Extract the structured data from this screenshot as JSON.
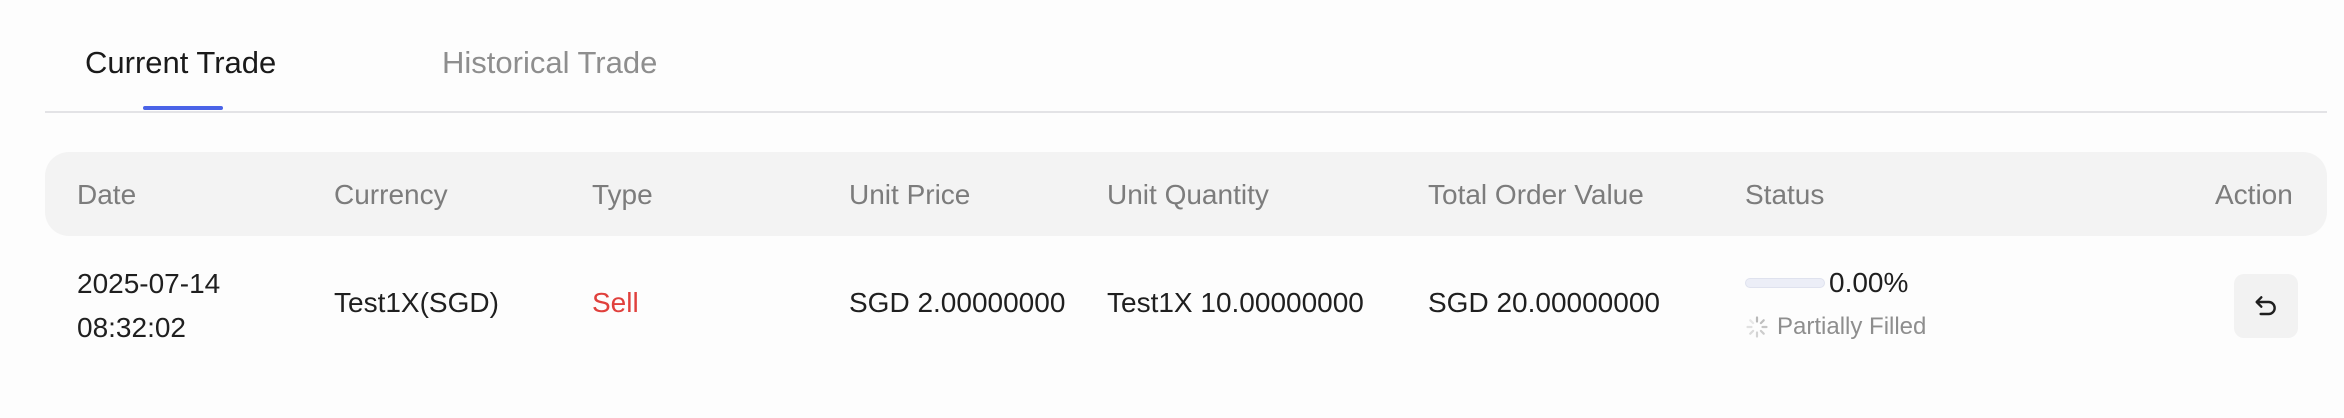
{
  "tabs": [
    {
      "label": "Current Trade",
      "active": true
    },
    {
      "label": "Historical Trade",
      "active": false
    }
  ],
  "table": {
    "columns": [
      "Date",
      "Currency",
      "Type",
      "Unit Price",
      "Unit Quantity",
      "Total Order Value",
      "Status",
      "Action"
    ],
    "rows": [
      {
        "date": "2025-07-14",
        "time": "08:32:02",
        "currency": "Test1X(SGD)",
        "type": "Sell",
        "unit_price": "SGD 2.00000000",
        "unit_quantity": "Test1X 10.00000000",
        "total_order_value": "SGD 20.00000000",
        "progress_percent": "0.00%",
        "progress_value": 0,
        "status": "Partially Filled",
        "action_icon": "undo-icon"
      }
    ]
  },
  "colors": {
    "accent": "#4a63e7",
    "sell": "#e0403c",
    "muted": "#8e8e8e"
  }
}
